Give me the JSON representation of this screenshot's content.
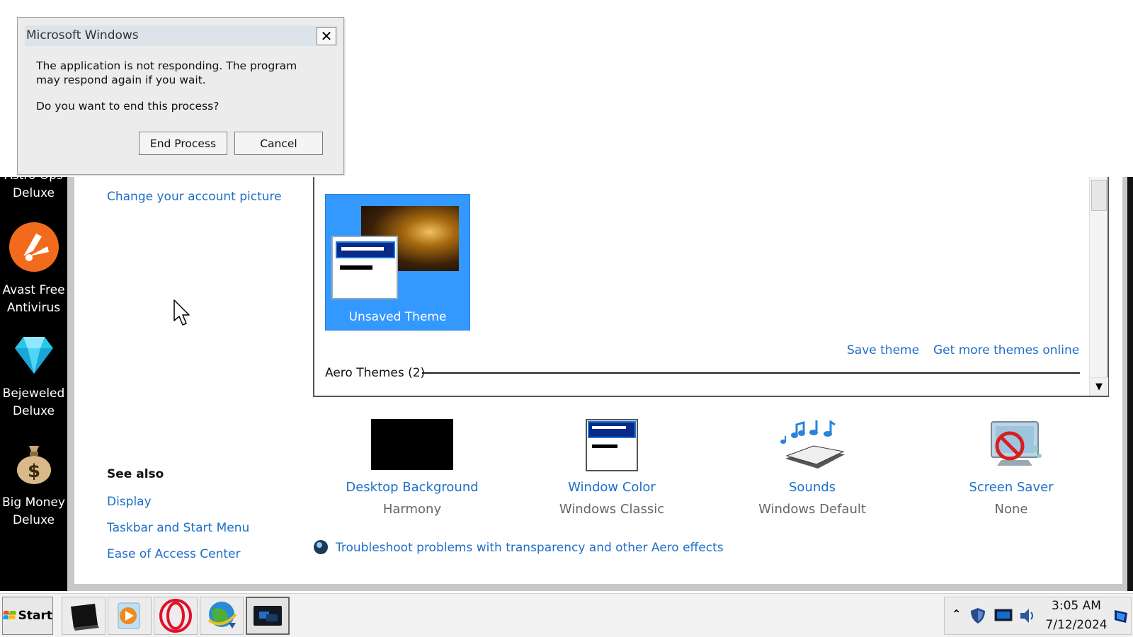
{
  "dialog": {
    "title": "Microsoft Windows",
    "message": "The application is not responding. The program may respond again if you wait.",
    "question": "Do you want to end this process?",
    "end_process_label": "End Process",
    "cancel_label": "Cancel"
  },
  "desktop": {
    "icons": [
      {
        "label1": "Astro Ops",
        "label2": "Deluxe",
        "icon": "game-icon"
      },
      {
        "label1": "Avast Free",
        "label2": "Antivirus",
        "icon": "avast-icon"
      },
      {
        "label1": "Bejeweled",
        "label2": "Deluxe",
        "icon": "diamond-icon"
      },
      {
        "label1": "Big Money",
        "label2": "Deluxe",
        "icon": "money-bag-icon"
      }
    ]
  },
  "left_pane": {
    "change_account_picture": "Change your account picture",
    "see_also_heading": "See also",
    "see_also_links": [
      "Display",
      "Taskbar and Start Menu",
      "Ease of Access Center"
    ]
  },
  "themes": {
    "selected_theme": "Unsaved Theme",
    "save_theme": "Save theme",
    "get_more_online": "Get more themes online",
    "aero_themes_label": "Aero Themes (2)"
  },
  "customize": [
    {
      "link": "Desktop Background",
      "value": "Harmony",
      "icon": "desktop-background-icon"
    },
    {
      "link": "Window Color",
      "value": "Windows Classic",
      "icon": "window-color-icon"
    },
    {
      "link": "Sounds",
      "value": "Windows Default",
      "icon": "sounds-icon"
    },
    {
      "link": "Screen Saver",
      "value": "None",
      "icon": "screen-saver-icon"
    }
  ],
  "troubleshoot_link": "Troubleshoot problems with transparency and other Aero effects",
  "taskbar": {
    "start_label": "Start",
    "time": "3:05 AM",
    "date": "7/12/2024"
  },
  "colors": {
    "link": "#1e6ec8",
    "selection": "#3399ff",
    "desktop": "#000000"
  }
}
